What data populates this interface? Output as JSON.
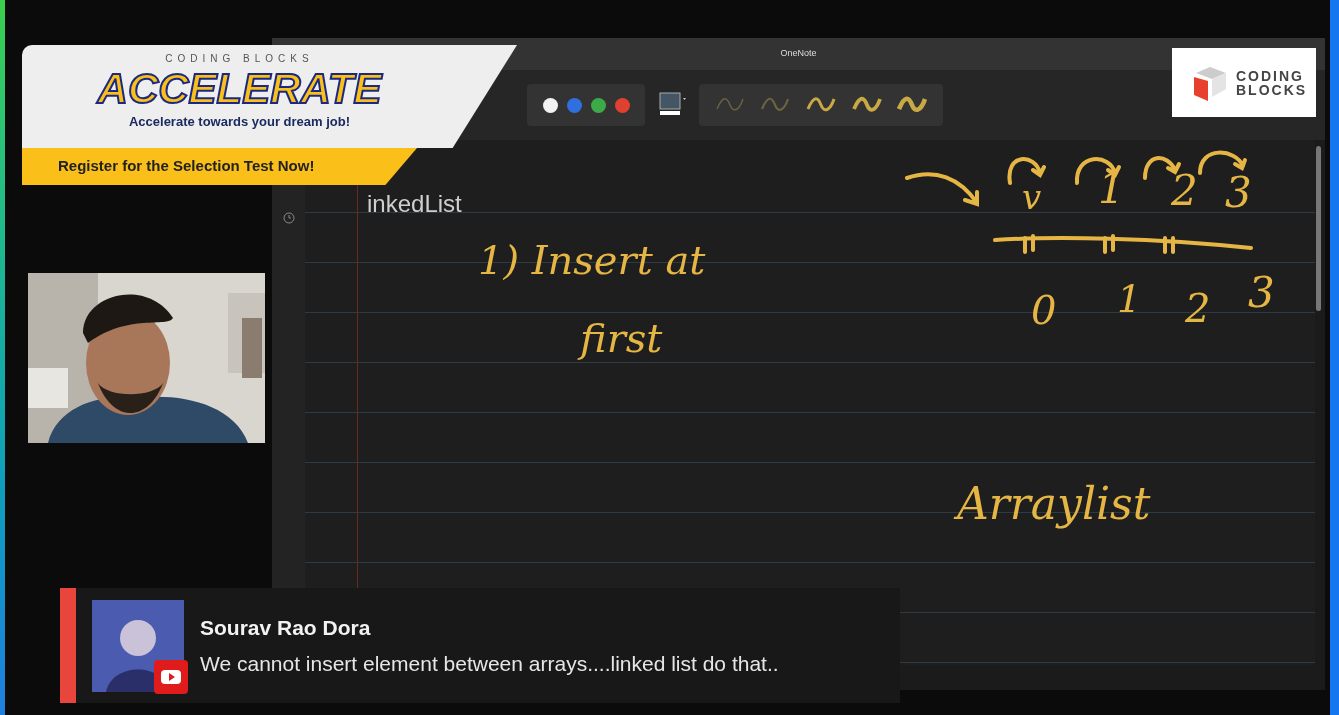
{
  "stream_banner": {
    "brand": "CODING BLOCKS",
    "title": "ACCELERATE",
    "tagline": "Accelerate towards your dream job!",
    "cta": "Register for the Selection Test Now!"
  },
  "window": {
    "title": "OneNote"
  },
  "toolbar": {
    "pen_colors": [
      {
        "color": "#f2f2f2"
      },
      {
        "color": "#2f6fe0"
      },
      {
        "color": "#3daa4a"
      },
      {
        "color": "#e0402f"
      }
    ]
  },
  "page": {
    "title": "inkedList",
    "ink": [
      {
        "text": "v"
      },
      {
        "text": "1"
      },
      {
        "text": "2"
      },
      {
        "text": "3"
      },
      {
        "text": "1) Insert at"
      },
      {
        "text": "0"
      },
      {
        "text": "1"
      },
      {
        "text": "2"
      },
      {
        "text": "3"
      },
      {
        "text": "first"
      },
      {
        "text": "Arraylist"
      }
    ]
  },
  "logo": {
    "line1": "CODING",
    "line2": "BLOCKS"
  },
  "chat": {
    "author": "Sourav Rao Dora",
    "message": "We cannot insert element between arrays....linked list do that.."
  }
}
